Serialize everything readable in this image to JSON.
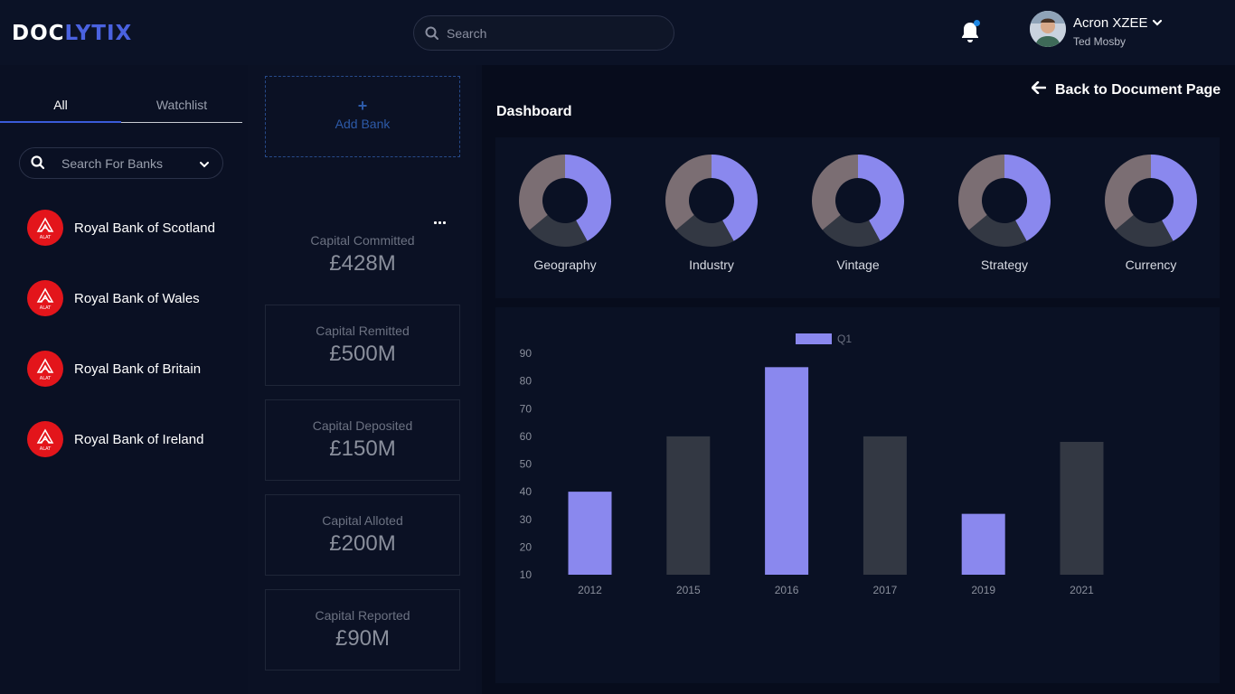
{
  "header": {
    "logo_part1": "DOC",
    "logo_part2": "LYTIX",
    "search_placeholder": "Search",
    "user_name": "Acron XZEE",
    "user_subtitle": "Ted Mosby"
  },
  "sidebar": {
    "tabs": [
      {
        "label": "All",
        "active": true
      },
      {
        "label": "Watchlist",
        "active": false
      }
    ],
    "search_placeholder": "Search For Banks",
    "bank_logo_text": "ALAT",
    "banks": [
      {
        "name": "Royal Bank of Scotland"
      },
      {
        "name": "Royal Bank of Wales"
      },
      {
        "name": "Royal Bank of Britain"
      },
      {
        "name": "Royal Bank of Ireland"
      }
    ]
  },
  "middle": {
    "add_bank_label": "Add Bank",
    "metrics": [
      {
        "title": "Capital Committed",
        "value": "£428M"
      },
      {
        "title": "Capital Remitted",
        "value": "£500M"
      },
      {
        "title": "Capital Deposited",
        "value": "£150M"
      },
      {
        "title": "Capital Alloted",
        "value": "£200M"
      },
      {
        "title": "Capital Reported",
        "value": "£90M"
      }
    ]
  },
  "main": {
    "back_label": "Back to Document Page",
    "dashboard_title": "Dashboard",
    "donuts": [
      {
        "label": "Geography",
        "segments": [
          42,
          22,
          36
        ]
      },
      {
        "label": "Industry",
        "segments": [
          42,
          22,
          36
        ]
      },
      {
        "label": "Vintage",
        "segments": [
          42,
          22,
          36
        ]
      },
      {
        "label": "Strategy",
        "segments": [
          42,
          22,
          36
        ]
      },
      {
        "label": "Currency",
        "segments": [
          42,
          22,
          36
        ]
      }
    ],
    "donut_colors": [
      "#8a88ee",
      "#333843",
      "#7b6e73"
    ]
  },
  "chart_data": {
    "type": "bar",
    "categories": [
      "2012",
      "2015",
      "2016",
      "2017",
      "2019",
      "2021"
    ],
    "series": [
      {
        "name": "Q1",
        "values": [
          40,
          60,
          85,
          60,
          32,
          58
        ]
      }
    ],
    "bar_colors": [
      "#8a88ee",
      "#333843",
      "#8a88ee",
      "#333843",
      "#8a88ee",
      "#333843"
    ],
    "legend_color": "#8a88ee",
    "ylim": [
      10,
      90
    ],
    "yticks": [
      10,
      20,
      30,
      40,
      50,
      60,
      70,
      80,
      90
    ],
    "legend": "top",
    "grid": false
  }
}
